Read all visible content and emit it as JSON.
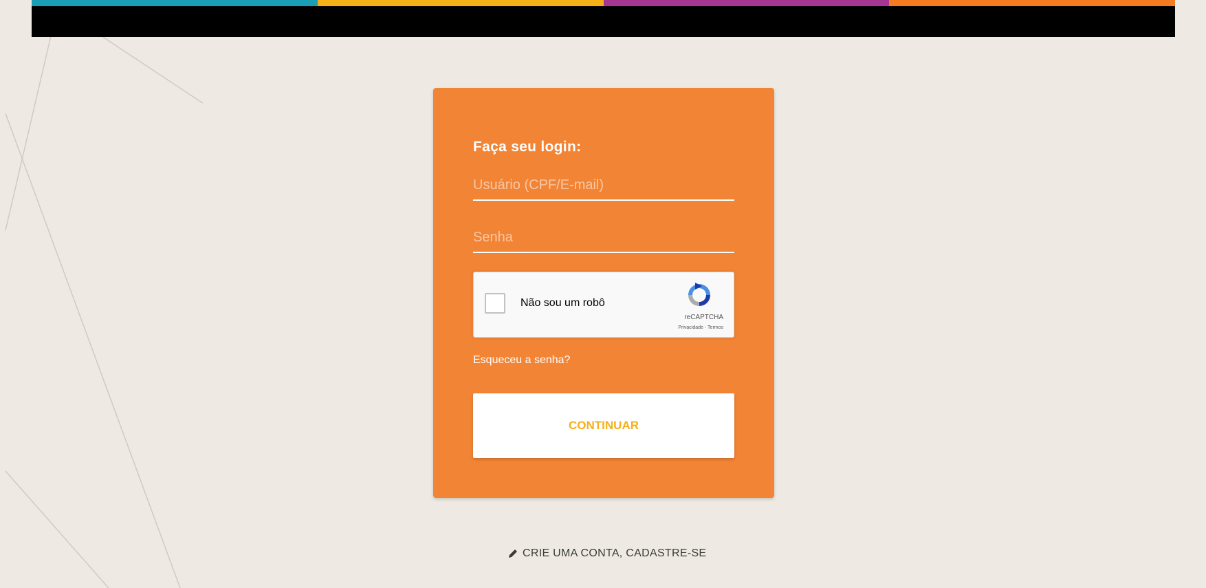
{
  "header": {
    "stripe_colors": [
      "#1A9FB5",
      "#F5AF19",
      "#A53691",
      "#F47B20"
    ],
    "bar_color": "#000000"
  },
  "login": {
    "title": "Faça seu login:",
    "username_placeholder": "Usuário (CPF/E-mail)",
    "username_value": "",
    "password_placeholder": "Senha",
    "password_value": "",
    "forgot_password": "Esqueceu a senha?",
    "continue_label": "CONTINUAR",
    "card_color": "#F28435",
    "button_text_color": "#F5AF19"
  },
  "recaptcha": {
    "label": "Não sou um robô",
    "brand": "reCAPTCHA",
    "privacy": "Privacidade",
    "separator": " - ",
    "terms": "Termos",
    "checked": false,
    "icon": "recaptcha-logo"
  },
  "footer": {
    "signup_icon": "pencil-icon",
    "signup_label": "CRIE UMA CONTA, CADASTRE-SE"
  }
}
